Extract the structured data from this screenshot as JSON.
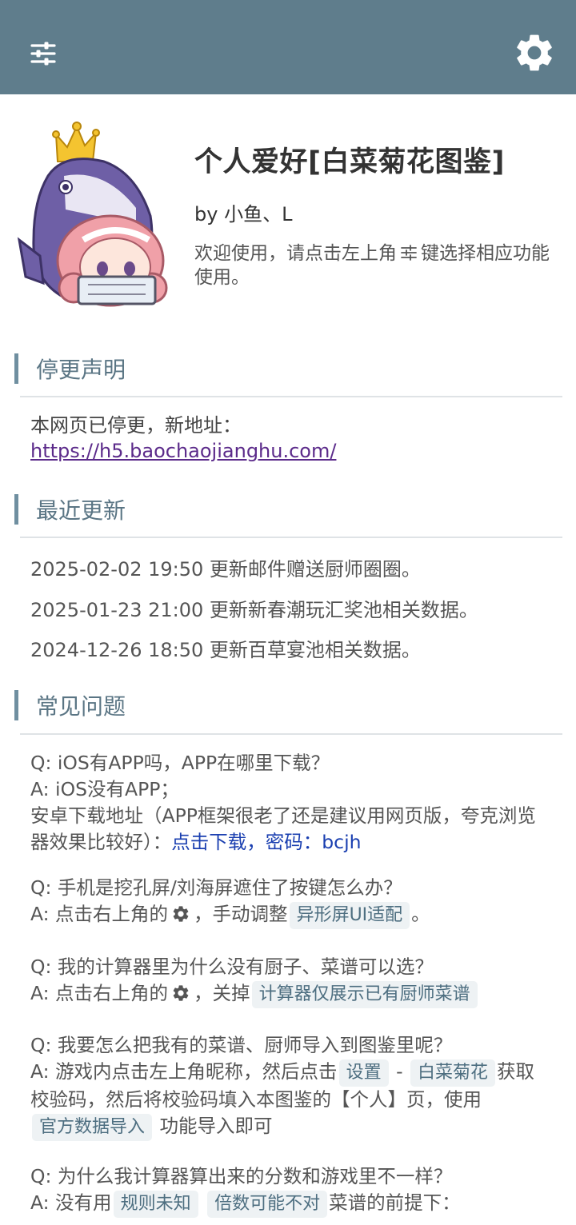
{
  "colors": {
    "topbar": "#5f7d8c",
    "accent": "#6f8fa0",
    "link": "#1a3fb0",
    "tag_bg": "#eef2f4"
  },
  "header": {
    "menu_icon": "sliders-icon",
    "settings_icon": "gear-icon"
  },
  "hero": {
    "title": "个人爱好[白菜菊花图鉴]",
    "author": "by 小鱼、L",
    "welcome_before": "欢迎使用，请点击左上角",
    "welcome_after": "键选择相应功能使用。"
  },
  "notice": {
    "title": "停更声明",
    "text": "本网页已停更，新地址：",
    "url": "https://h5.baochaojianghu.com/"
  },
  "updates": {
    "title": "最近更新",
    "items": [
      "2025-02-02 19:50 更新邮件赠送厨师圈圈。",
      "2025-01-23 21:00 更新新春潮玩汇奖池相关数据。",
      "2024-12-26 18:50 更新百草宴池相关数据。"
    ]
  },
  "faq": {
    "title": "常见问题",
    "q1": "Q: iOS有APP吗，APP在哪里下载？",
    "a1_line1": "A: iOS没有APP；",
    "a1_line2": "安卓下载地址（APP框架很老了还是建议用网页版，夸克浏览器效果比较好）：",
    "a1_link": "点击下载，密码：bcjh",
    "q2": "Q: 手机是挖孔屏/刘海屏遮住了按键怎么办？",
    "a2_before": "A: 点击右上角的",
    "a2_mid": "，手动调整",
    "a2_tag": "异形屏UI适配",
    "a2_after": "。",
    "q3": "Q: 我的计算器里为什么没有厨子、菜谱可以选？",
    "a3_before": "A: 点击右上角的",
    "a3_mid": "，关掉",
    "a3_tag": "计算器仅展示已有厨师菜谱",
    "q4": "Q: 我要怎么把我有的菜谱、厨师导入到图鉴里呢？",
    "a4_before": "A: 游戏内点击左上角昵称，然后点击",
    "a4_tag1": "设置",
    "a4_sep": "-",
    "a4_tag2": "白菜菊花",
    "a4_mid": "获取校验码，然后将校验码填入本图鉴的【个人】页，使用",
    "a4_tag3": "官方数据导入",
    "a4_after": "功能导入即可",
    "q5": "Q: 为什么我计算器算出来的分数和游戏里不一样？",
    "a5_before": "A: 没有用",
    "a5_tag1": "规则未知",
    "a5_tag2": "倍数可能不对",
    "a5_after": "菜谱的前提下："
  }
}
